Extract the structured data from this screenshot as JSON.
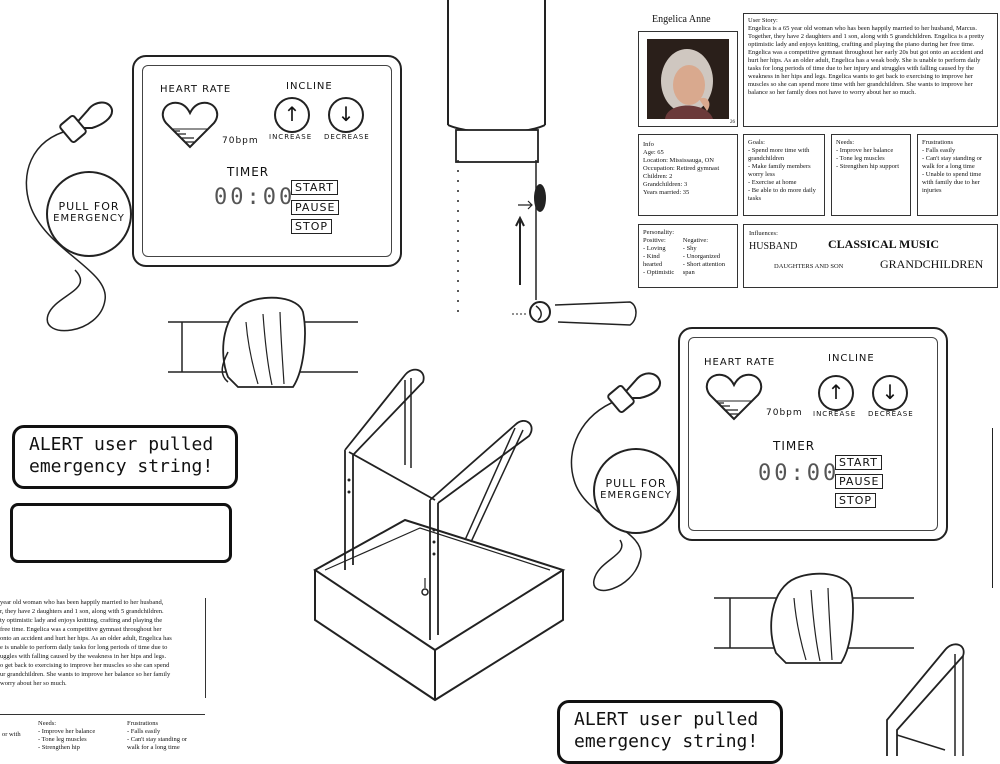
{
  "monitor": {
    "heart_rate_label": "HEART RATE",
    "incline_label": "INCLINE",
    "bpm": "70bpm",
    "increase": "INCREASE",
    "decrease": "DECREASE",
    "timer_label": "TIMER",
    "timer_value": "00:00",
    "start": "START",
    "pause": "PAUSE",
    "stop": "STOP"
  },
  "emergency": {
    "label_line1": "PULL FOR",
    "label_line2": "EMERGENCY"
  },
  "alert": {
    "line1": "ALERT user pulled",
    "line2": "emergency string!"
  },
  "persona": {
    "name": "Engelica Anne",
    "photo_number": "26",
    "user_story_title": "User Story:",
    "user_story": "Engelica is a 65 year old woman who has been happily married to her husband, Marcus. Together, they have 2 daughters and 1 son, along with 5 grandchildren. Engelica is a pretty optimistic lady and enjoys knitting, crafting and playing the piano during her free time. Engelica was a competitive gymnast throughout her early 20s but got onto an accident and hurt her hips. As an older adult, Engelica has a weak body. She is unable to perform daily tasks for long periods of time due to her injury and struggles with falling caused by the weakness in her hips and legs. Engelica wants to get back to exercising to improve her muscles so she can spend more time with her grandchildren. She wants to improve her balance so her family does not have to worry about her so much.",
    "info_title": "Info",
    "info": [
      "Age: 65",
      "Location: Mississauga, ON",
      "Occupation: Retired gymnast",
      "Children: 2",
      "Grandchildren: 3",
      "Years married: 35"
    ],
    "goals_title": "Goals:",
    "goals": [
      "- Spend more time with grandchildren",
      "- Make family members worry less",
      "- Exercise at home",
      "- Be able to do more daily tasks"
    ],
    "needs_title": "Needs:",
    "needs": [
      "- Improve her balance",
      "- Tone leg muscles",
      "- Strengthen hip support"
    ],
    "frustrations_title": "Frustrations",
    "frustrations": [
      "- Falls easily",
      "- Can't stay standing or walk for a long time",
      "- Unable to spend time with family due to her injuries"
    ],
    "personality_title": "Personality:",
    "positive_title": "Positive:",
    "positive": [
      "- Loving",
      "- Kind hearted",
      "- Optimistic"
    ],
    "negative_title": "Negative:",
    "negative": [
      "- Shy",
      "- Unorganized",
      "- Short attention span"
    ],
    "influences_title": "Influences:",
    "influence_husband": "HUSBAND",
    "influence_music": "CLASSICAL MUSIC",
    "influence_daughters": "DAUGHTERS AND SON",
    "influence_grandchildren": "GRANDCHILDREN"
  },
  "partial_story": [
    "year old woman who has been happily married to her husband,",
    "r, they have 2 daughters and 1 son, along with 5 grandchildren.",
    "ty optimistic lady and enjoys knitting, crafting and playing the",
    "free time. Engelica was a competitive gymnast throughout her",
    "onto an accident and hurt her hips. As an older adult, Engelica has",
    "e is unable to perform daily tasks for long periods of time due to",
    "uggles with falling caused by the weakness in her hips and legs.",
    "o get back to exercising to improve her muscles so she can spend",
    "ur grandchildren. She wants to improve her balance so her family",
    "worry about her so much."
  ],
  "partial_bottom": {
    "goals_tail": "or with",
    "needs_title": "Needs:",
    "needs": [
      "- Improve her balance",
      "- Tone leg muscles",
      "- Strengthen hip"
    ],
    "frustrations_title": "Frustrations",
    "frustrations": [
      "- Falls easily",
      "- Can't stay standing or",
      "walk for a long time"
    ]
  }
}
